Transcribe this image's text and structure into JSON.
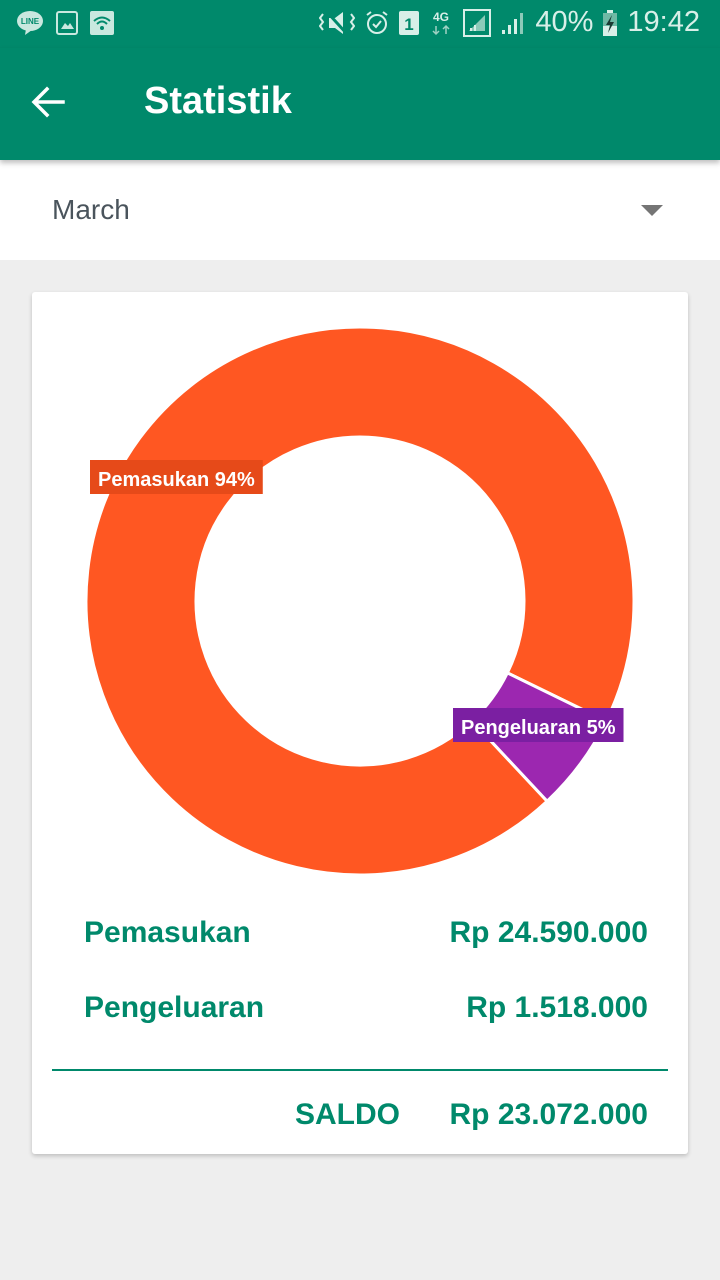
{
  "status_bar": {
    "left_icons": [
      "line-app-icon",
      "image-notification-icon",
      "wifi-notification-icon"
    ],
    "right_icons": [
      "vibrate-mute-icon",
      "alarm-icon",
      "sim-1-icon",
      "4g-data-icon",
      "signal-sim1-icon",
      "signal-sim2-icon"
    ],
    "battery": "40%",
    "time": "19:42"
  },
  "app_bar": {
    "title": "Statistik",
    "back_icon": "arrow-back-icon"
  },
  "month_selector": {
    "selected": "March"
  },
  "colors": {
    "primary": "#00896b",
    "income": "#ff5722",
    "income_label_bg": "#e64a19",
    "expense": "#9c27b0",
    "expense_label_bg": "#7b1fa2"
  },
  "chart_data": {
    "type": "pie",
    "style": "donut",
    "title": "",
    "slices": [
      {
        "name": "Pemasukan",
        "value": 24590000,
        "label": "Pemasukan 94%",
        "color": "#ff5722"
      },
      {
        "name": "Pengeluaran",
        "value": 1518000,
        "label": "Pengeluaran 5%",
        "color": "#9c27b0"
      }
    ],
    "legend": "none"
  },
  "summary": {
    "rows": [
      {
        "label": "Pemasukan",
        "value": "Rp 24.590.000"
      },
      {
        "label": "Pengeluaran",
        "value": "Rp 1.518.000"
      }
    ],
    "total_label": "SALDO",
    "total_value": "Rp 23.072.000"
  }
}
